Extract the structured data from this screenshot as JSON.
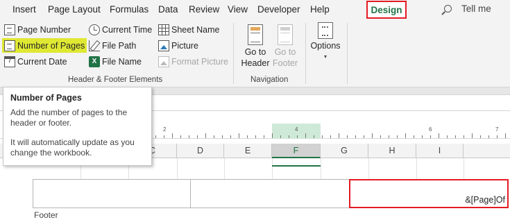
{
  "menu": {
    "items": [
      "Insert",
      "Page Layout",
      "Formulas",
      "Data",
      "Review",
      "View",
      "Developer",
      "Help"
    ],
    "active_tab": "Design",
    "tell_me": "Tell me"
  },
  "ribbon": {
    "header_footer_elements": {
      "page_number": "Page Number",
      "number_of_pages": "Number of Pages",
      "current_date": "Current Date",
      "current_time": "Current Time",
      "file_path": "File Path",
      "file_name": "File Name",
      "sheet_name": "Sheet Name",
      "picture": "Picture",
      "format_picture": "Format Picture",
      "group_label": "Header & Footer Elements"
    },
    "navigation": {
      "go_to_header_line1": "Go to",
      "go_to_header_line2": "Header",
      "go_to_footer_line1": "Go to",
      "go_to_footer_line2": "Footer",
      "group_label": "Navigation"
    },
    "options": {
      "label": "Options",
      "caret": "▾"
    },
    "icons": {
      "current_date_glyph": "7",
      "file_name_glyph": "X"
    }
  },
  "ruler": {
    "numbers": [
      "2",
      "4",
      "6",
      "7"
    ]
  },
  "columns": [
    "C",
    "D",
    "E",
    "F",
    "G",
    "H",
    "I"
  ],
  "active_column": "F",
  "footer": {
    "right_section_text": "&[Page]Of",
    "label": "Footer"
  },
  "tooltip": {
    "title": "Number of Pages",
    "body_line1": "Add the number of pages to the",
    "body_line2": "header or footer.",
    "body_line3": "It will automatically update as you",
    "body_line4": "change the workbook."
  },
  "colors": {
    "accent_green": "#217346",
    "highlight_red": "#e31b23",
    "highlight_yellow": "#dfe832"
  }
}
